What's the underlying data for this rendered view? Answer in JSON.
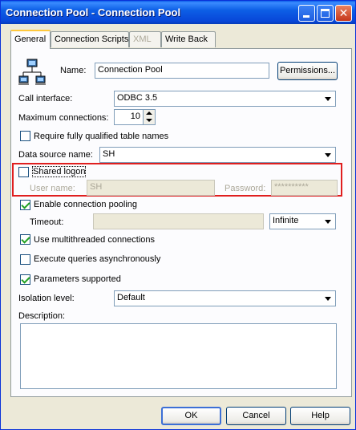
{
  "window": {
    "title": "Connection Pool - Connection Pool"
  },
  "tabs": [
    "General",
    "Connection Scripts",
    "XML",
    "Write Back"
  ],
  "form": {
    "name_label": "Name:",
    "name_value": "Connection Pool",
    "permissions_label": "Permissions...",
    "call_interface_label": "Call interface:",
    "call_interface_value": "ODBC 3.5",
    "max_connections_label": "Maximum connections:",
    "max_connections_value": "10",
    "require_qualified_label": "Require fully qualified table names",
    "data_source_label": "Data source name:",
    "data_source_value": "SH",
    "shared_logon_label": "Shared logon",
    "user_name_label": "User name:",
    "user_name_value": "SH",
    "password_label": "Password:",
    "password_value": "**********",
    "enable_pooling_label": "Enable connection pooling",
    "timeout_label": "Timeout:",
    "timeout_value": "",
    "timeout_unit": "Infinite",
    "multithreaded_label": "Use multithreaded connections",
    "async_label": "Execute queries asynchronously",
    "params_supported_label": "Parameters supported",
    "isolation_label": "Isolation level:",
    "isolation_value": "Default",
    "description_label": "Description:",
    "description_value": ""
  },
  "footer": {
    "ok_label": "OK",
    "cancel_label": "Cancel",
    "help_label": "Help"
  },
  "checks": {
    "require_qualified": false,
    "shared_logon": false,
    "enable_pooling": true,
    "multithreaded": true,
    "async": false,
    "params_supported": true
  },
  "colors": {
    "titlebar": "#0a5ce8",
    "highlight": "#e01f1f",
    "face": "#ece9d8"
  }
}
